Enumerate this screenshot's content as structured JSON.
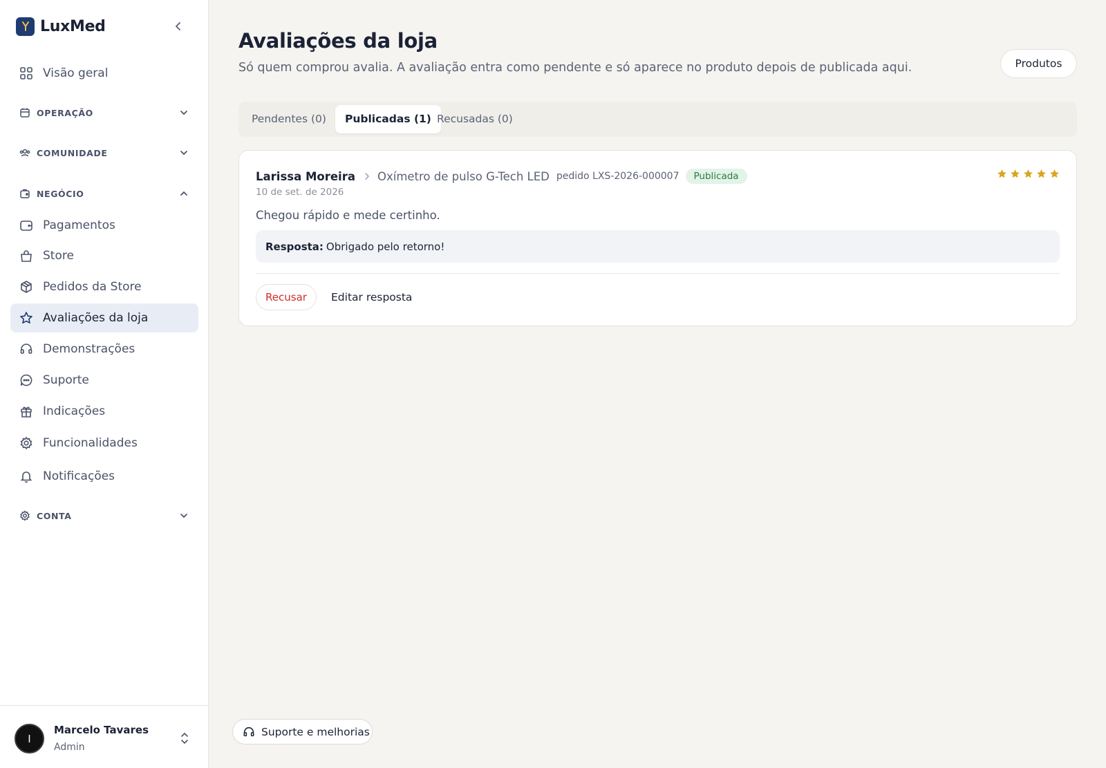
{
  "brand": {
    "name": "LuxMed",
    "accent": "#1f3b72"
  },
  "sidebar": {
    "overview": {
      "label": "Visão geral",
      "icon": "grid-icon"
    },
    "sections": [
      {
        "label": "OPERAÇÃO",
        "icon": "calendar-icon",
        "expanded": false
      },
      {
        "label": "COMUNIDADE",
        "icon": "users-icon",
        "expanded": false
      },
      {
        "label": "NEGÓCIO",
        "icon": "briefcase-icon",
        "expanded": true
      },
      {
        "label": "CONTA",
        "icon": "gear-icon",
        "expanded": false
      }
    ],
    "items": [
      {
        "label": "Pagamentos",
        "icon": "wallet-icon"
      },
      {
        "label": "Store",
        "icon": "bag-icon"
      },
      {
        "label": "Pedidos da Store",
        "icon": "box-icon"
      },
      {
        "label": "Avaliações da loja",
        "icon": "star-icon",
        "active": true
      },
      {
        "label": "Demonstrações",
        "icon": "headset-icon"
      },
      {
        "label": "Suporte",
        "icon": "chat-icon"
      },
      {
        "label": "Indicações",
        "icon": "gift-icon"
      },
      {
        "label": "Funcionalidades",
        "icon": "gear-icon"
      },
      {
        "label": "Notificações",
        "icon": "bell-icon"
      }
    ],
    "user": {
      "name": "Marcelo Tavares",
      "role": "Admin",
      "initial": "I"
    }
  },
  "page": {
    "title": "Avaliações da loja",
    "subtitle": "Só quem comprou avalia. A avaliação entra como pendente e só aparece no produto depois de publicada aqui.",
    "products_button": "Produtos"
  },
  "tabs": [
    {
      "label": "Pendentes (0)",
      "active": false
    },
    {
      "label": "Publicadas (1)",
      "active": true
    },
    {
      "label": "Recusadas (0)",
      "active": false
    }
  ],
  "review": {
    "author": "Larissa Moreira",
    "product": "Oxímetro de pulso G-Tech LED",
    "order": "pedido LXS-2026-000007",
    "status": "Publicada",
    "date": "10 de set. de 2026",
    "rating": 5,
    "rating_max": 5,
    "body": "Chegou rápido e mede certinho.",
    "reply_label": "Resposta:",
    "reply_text": "Obrigado pelo retorno!",
    "reject_button": "Recusar",
    "edit_button": "Editar resposta"
  },
  "support_button": "Suporte e melhorias",
  "colors": {
    "danger": "#d22d2d",
    "success": "#2f7a44",
    "star": "#d9a520"
  }
}
